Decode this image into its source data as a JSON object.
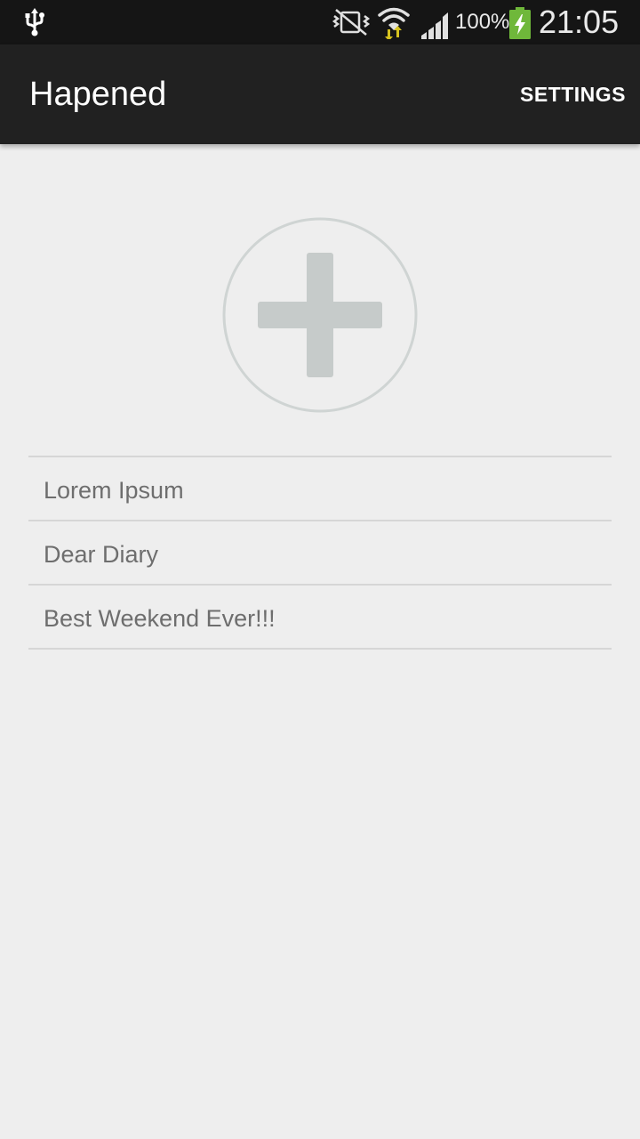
{
  "status_bar": {
    "battery_percent": "100%",
    "time": "21:05",
    "icons": [
      "usb-icon",
      "mute-icon",
      "wifi-icon",
      "signal-icon",
      "battery-charging-icon"
    ],
    "battery_color": "#6fb83a",
    "wifi_arrows_color": "#d6c21f"
  },
  "action_bar": {
    "title": "Hapened",
    "settings_label": "SETTINGS"
  },
  "add_button": {
    "icon": "plus-icon",
    "color": "#c6cbca"
  },
  "entries": [
    {
      "title": "Lorem Ipsum"
    },
    {
      "title": "Dear Diary"
    },
    {
      "title": "Best Weekend Ever!!!"
    }
  ]
}
